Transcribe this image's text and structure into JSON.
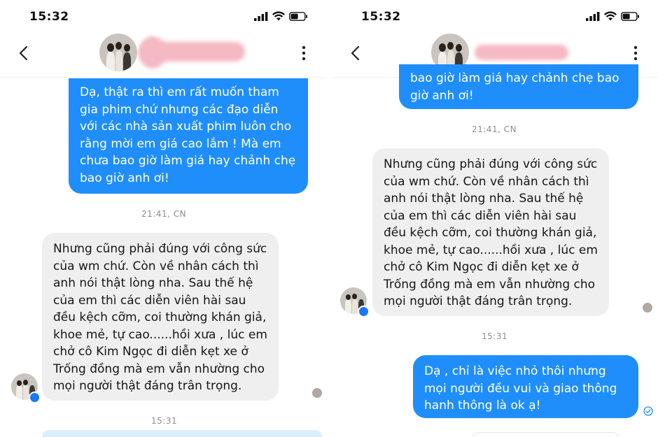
{
  "left": {
    "status_time": "15:32",
    "messages": {
      "out1": "Dạ, thật ra thì em rất muốn tham gia phim chứ nhưng các đạo diễn với các nhà sản xuất phim luôn cho rằng mời em giá cao lắm ! Mà em chưa bao giờ làm giá hay chảnh chẹ bao giờ anh ơi!",
      "ts1": "21:41, CN",
      "in1": "Nhưng cũng phải đúng với công sức của wm chứ. Còn về nhân cách thì anh nói thật lòng nha. Sau thế hệ của em thì các diễn viên hài sau đều kệch cỡm, coi thường khán giả, khoe mẻ, tự cao......hồi xưa , lúc em chở cô Kim Ngọc đi diễn kẹt xe ở Trống đồng mà em vẫn nhường cho mọi người thật đáng trân trọng.",
      "ts2": "15:31"
    }
  },
  "right": {
    "status_time": "15:32",
    "messages": {
      "out0": "bao giờ làm giá hay chảnh chẹ bao giờ anh ơi!",
      "ts1": "21:41, CN",
      "in1": "Nhưng cũng phải đúng với công sức của wm chứ. Còn về nhân cách thì anh nói thật lòng nha. Sau thế hệ của em thì các diễn viên hài sau đều kệch cỡm, coi thường khán giả, khoe mẻ, tự cao......hồi xưa , lúc em chở cô Kim Ngọc đi diễn kẹt xe ở Trống đồng mà em vẫn nhường cho mọi người thật đáng trân trọng.",
      "ts2": "15:31",
      "out2": "Dạ , chỉ là việc nhỏ thôi nhưng mọi người đều vui và giao thông hanh thông là ok ạ!"
    }
  },
  "colors": {
    "outgoing_bubble": "#1f8efa",
    "incoming_bubble": "#efefef",
    "name_redaction": "#f5b9c3",
    "messenger_badge": "#1877f2"
  },
  "icons": [
    "back-chevron-icon",
    "more-vertical-icon",
    "signal-icon",
    "wifi-icon",
    "battery-icon",
    "messenger-badge-icon",
    "sent-check-icon"
  ]
}
